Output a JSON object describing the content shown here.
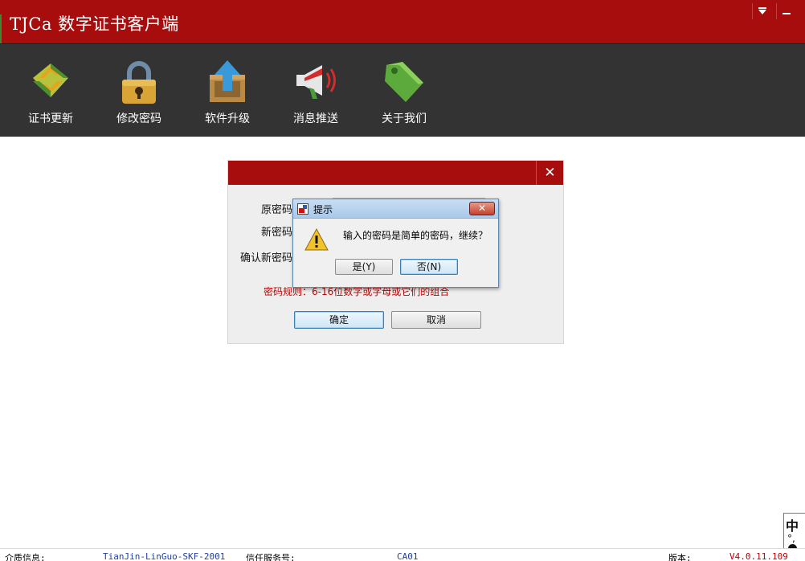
{
  "window": {
    "title": "TJCa 数字证书客户端"
  },
  "toolbar": {
    "items": [
      {
        "label": "证书更新",
        "icon": "refresh-arrows-icon"
      },
      {
        "label": "修改密码",
        "icon": "padlock-icon"
      },
      {
        "label": "软件升级",
        "icon": "upload-box-icon"
      },
      {
        "label": "消息推送",
        "icon": "megaphone-icon"
      },
      {
        "label": "关于我们",
        "icon": "tag-icon"
      }
    ]
  },
  "change_password_dialog": {
    "close_symbol": "✕",
    "labels": {
      "old_password": "原密码",
      "new_password": "新密码",
      "confirm_password": "确认新密码"
    },
    "rule_text": "密码规则：6-16位数字或字母或它们的组合",
    "ok_label": "确定",
    "cancel_label": "取消"
  },
  "prompt": {
    "title": "提示",
    "message": "输入的密码是简单的密码，继续？",
    "yes_label": "是(Y)",
    "no_label": "否(N)",
    "close_symbol": "✕"
  },
  "statusbar": {
    "medium_label": "介质信息:",
    "medium_value": "TianJin-LinGuo-SKF-2001",
    "trust_label": "信任服务号:",
    "trust_value": "CA01",
    "version_label": "版本:",
    "version_value": "V4.0.11.109"
  },
  "ime": {
    "main": "中",
    "sub": "°,"
  },
  "colors": {
    "brand_red": "#a80d0d",
    "toolbar_bg": "#333333",
    "rule_red": "#c00000",
    "status_blue": "#1f3fa8"
  }
}
